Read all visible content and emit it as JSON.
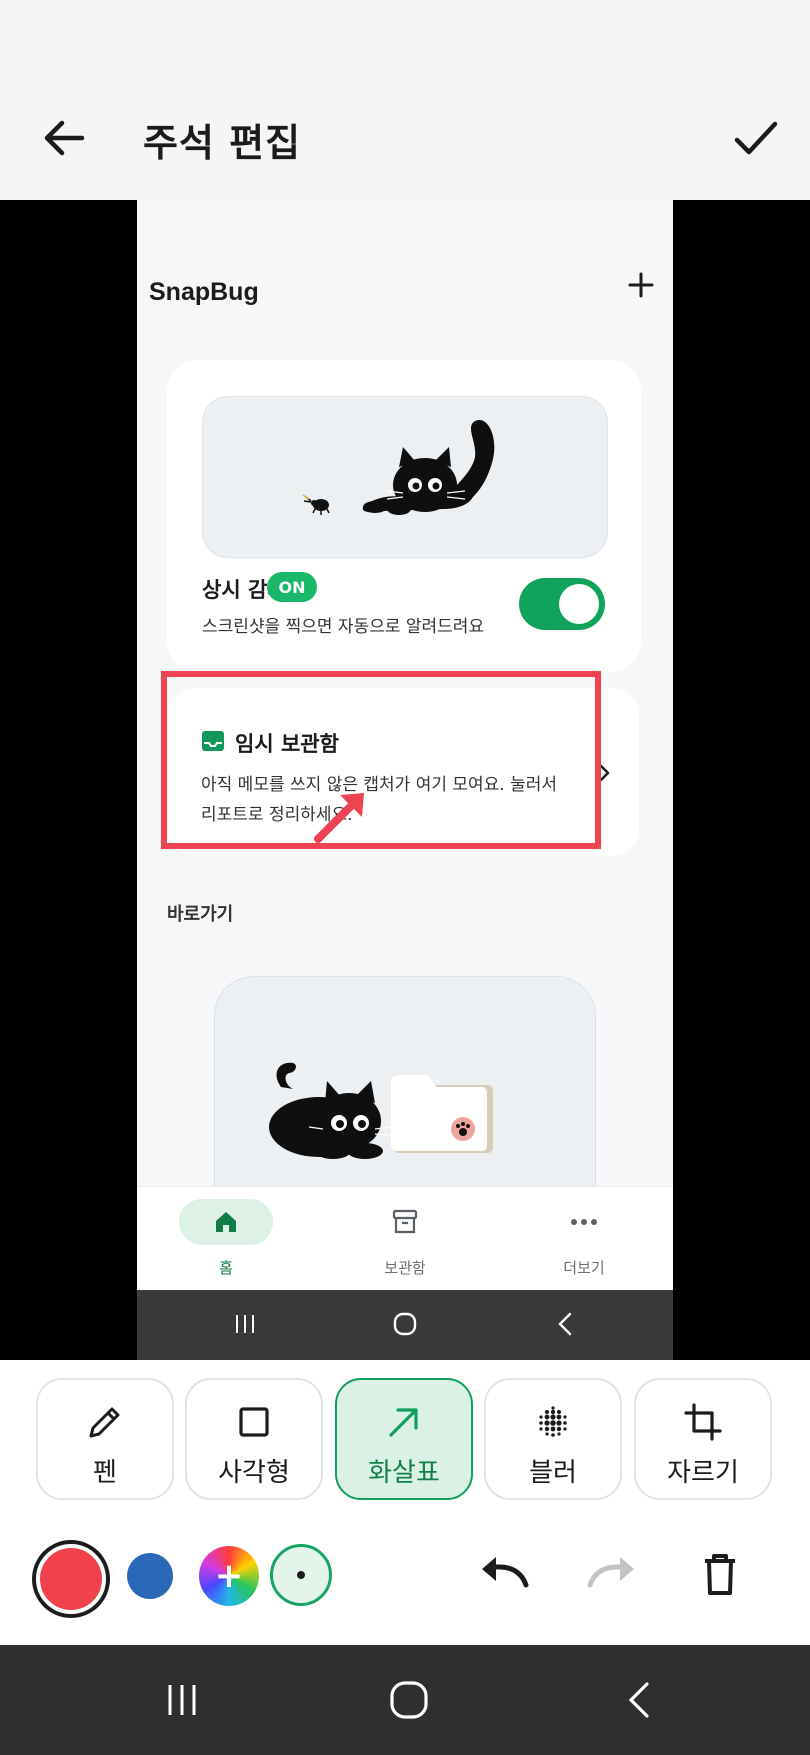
{
  "header": {
    "title": "주석 편집"
  },
  "screenshot": {
    "app_title": "SnapBug",
    "monitor": {
      "label": "상시 감시",
      "badge": "ON",
      "description": "스크린샷을 찍으면 자동으로 알려드려요",
      "toggle_on": true
    },
    "inbox": {
      "title": "임시 보관함",
      "description": "아직 메모를 쓰지 않은 캡처가 여기 모여요. 눌러서 리포트로 정리하세요."
    },
    "shortcut_label": "바로가기",
    "nav": [
      {
        "label": "홈",
        "icon": "home-icon"
      },
      {
        "label": "보관함",
        "icon": "archive-icon"
      },
      {
        "label": "더보기",
        "icon": "more-icon"
      }
    ]
  },
  "tools": [
    {
      "label": "펜",
      "icon": "pen-icon"
    },
    {
      "label": "사각형",
      "icon": "rectangle-icon"
    },
    {
      "label": "화살표",
      "icon": "arrow-icon",
      "active": true
    },
    {
      "label": "블러",
      "icon": "blur-icon"
    },
    {
      "label": "자르기",
      "icon": "crop-icon"
    }
  ],
  "colors": {
    "selected": "#f0414c",
    "blue": "#2b68b5",
    "accent": "#10a35c",
    "annotation": "#ee4352"
  }
}
